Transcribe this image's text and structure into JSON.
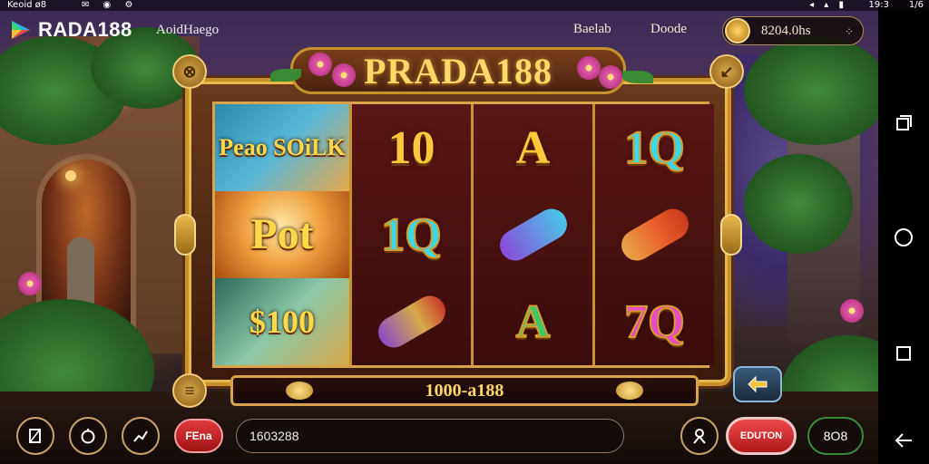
{
  "status_bar": {
    "left_label": "Keoid ø8",
    "icons": [
      "mail-icon",
      "notification-icon",
      "settings-icon",
      "cast-icon",
      "wifi-icon",
      "shield-icon"
    ],
    "time": "19:3",
    "extra": "1/6"
  },
  "header": {
    "logo_text": "RADA188",
    "sub_label": "AoidHaego",
    "links": [
      "Baelab",
      "Doode"
    ],
    "balance": "8204.0hs"
  },
  "machine": {
    "title": "PRADA188",
    "feature_tiles": [
      "Peao SOiLK",
      "Pot",
      "$100"
    ],
    "reels": [
      [
        "10",
        "1Q",
        "scroll-red"
      ],
      [
        "A",
        "scroll-blue",
        "A"
      ],
      [
        "1Q",
        "scroll-orange",
        "7Q"
      ]
    ],
    "win_display": "1000-a188"
  },
  "controls": {
    "bet_label": "FEna",
    "bet_value": "1603288",
    "spin_label": "EDUTON",
    "auto_label": "8O8"
  },
  "colors": {
    "accent_gold": "#c8922a",
    "spin_red": "#e03a3a",
    "reel_bg": "#5a1614"
  }
}
